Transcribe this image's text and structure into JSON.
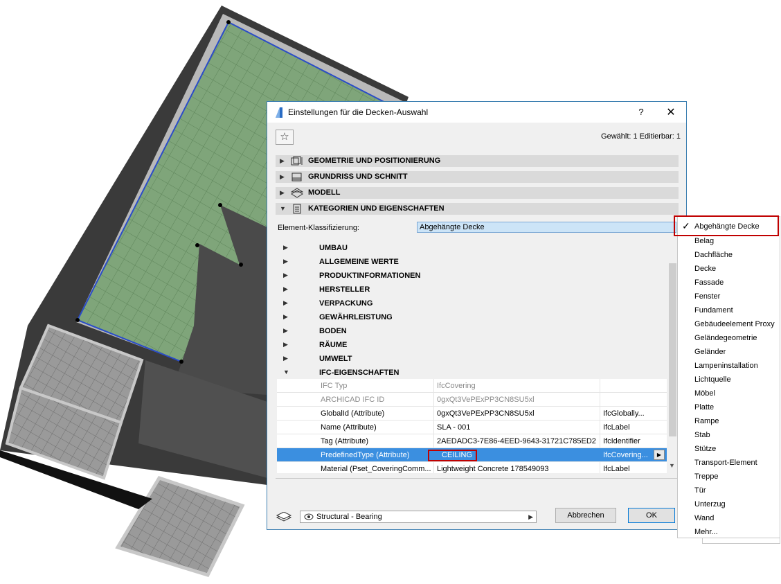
{
  "dialog": {
    "title": "Einstellungen für die Decken-Auswahl",
    "help_label": "?",
    "close_label": "✕",
    "favorites_icon": "star-icon",
    "selection_info": "Gewählt: 1 Editierbar: 1"
  },
  "panels": [
    {
      "label": "GEOMETRIE UND POSITIONIERUNG",
      "icon": "geometry-icon",
      "expanded": false
    },
    {
      "label": "GRUNDRISS UND SCHNITT",
      "icon": "floorplan-icon",
      "expanded": false
    },
    {
      "label": "MODELL",
      "icon": "model-icon",
      "expanded": false
    },
    {
      "label": "KATEGORIEN UND EIGENSCHAFTEN",
      "icon": "categories-icon",
      "expanded": true
    }
  ],
  "classification": {
    "label": "Element-Klassifizierung:",
    "value": "Abgehängte Decke"
  },
  "groups": [
    "UMBAU",
    "ALLGEMEINE WERTE",
    "PRODUKTINFORMATIONEN",
    "HERSTELLER",
    "VERPACKUNG",
    "GEWÄHRLEISTUNG",
    "BODEN",
    "RÄUME",
    "UMWELT"
  ],
  "ifc_group": "IFC-EIGENSCHAFTEN",
  "ifc_rows": [
    {
      "name": "IFC Typ",
      "value": "IfcCovering",
      "type": "",
      "state": "grey"
    },
    {
      "name": "ARCHICAD IFC ID",
      "value": "0gxQt3VePExPP3CN8SU5xl",
      "type": "",
      "state": "grey"
    },
    {
      "name": "GlobalId (Attribute)",
      "value": "0gxQt3VePExPP3CN8SU5xl",
      "type": "IfcGlobally...",
      "state": "normal"
    },
    {
      "name": "Name (Attribute)",
      "value": "SLA - 001",
      "type": "IfcLabel",
      "state": "normal"
    },
    {
      "name": "Tag (Attribute)",
      "value": "2AEDADC3-7E86-4EED-9643-31721C785ED2",
      "type": "IfcIdentifier",
      "state": "normal"
    },
    {
      "name": "PredefinedType (Attribute)",
      "value": "CEILING",
      "type": "IfcCovering...",
      "state": "selected"
    },
    {
      "name": "Material (Pset_CoveringComm...",
      "value": "Lightweight Concrete 178549093",
      "type": "IfcLabel",
      "state": "normal"
    }
  ],
  "footer": {
    "layer_value": "Structural - Bearing",
    "cancel_label": "Abbrechen",
    "ok_label": "OK"
  },
  "dropdown": {
    "selected": "Abgehängte Decke",
    "items": [
      "Abgehängte Decke",
      "Belag",
      "Dachfläche",
      "Decke",
      "Fassade",
      "Fenster",
      "Fundament",
      "Gebäudeelement Proxy",
      "Geländegeometrie",
      "Geländer",
      "Lampeninstallation",
      "Lichtquelle",
      "Möbel",
      "Platte",
      "Rampe",
      "Stab",
      "Stütze",
      "Transport-Element",
      "Treppe",
      "Tür",
      "Unterzug",
      "Wand",
      "Mehr..."
    ]
  },
  "colors": {
    "selection_blue": "#3b8fe0",
    "highlight_red": "#c00000",
    "slab_green": "#6f9e6a"
  }
}
